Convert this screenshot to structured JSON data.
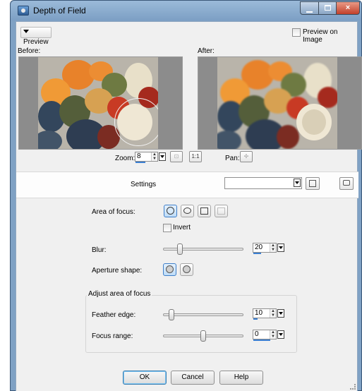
{
  "window": {
    "title": "Depth of Field",
    "colors": {
      "titlebar": "#7c9fc4",
      "client": "#f0f0f0",
      "accent": "#3b7fd2"
    }
  },
  "window_buttons": {
    "minimize": "minimize-icon",
    "maximize": "maximize-icon",
    "close": "close-icon",
    "close_glyph": "×"
  },
  "preview": {
    "toggle_label": "Preview",
    "preview_on_image_label": "Preview on Image"
  },
  "panes": {
    "before_label": "Before:",
    "after_label": "After:"
  },
  "zoom": {
    "label": "Zoom:",
    "value": "8"
  },
  "pan": {
    "label": "Pan:",
    "glyph": "✢"
  },
  "settings": {
    "label": "Settings",
    "selected": ""
  },
  "area_of_focus": {
    "label": "Area of focus:",
    "invert_label": "Invert",
    "shapes": [
      "circle-icon",
      "lasso-icon",
      "rectangle-icon",
      "rectangle-disabled-icon"
    ]
  },
  "blur": {
    "label": "Blur:",
    "value": "20"
  },
  "aperture": {
    "label": "Aperture shape:",
    "shapes": [
      "circle-aperture-icon",
      "round-aperture-icon"
    ]
  },
  "adjust": {
    "group_title": "Adjust area of focus",
    "feather_label": "Feather edge:",
    "feather_value": "10",
    "focus_label": "Focus range:",
    "focus_value": "0"
  },
  "buttons": {
    "ok": "OK",
    "cancel": "Cancel",
    "help": "Help"
  },
  "icons": {
    "zoom_reset": "⊡",
    "one_to_one": "1:1"
  }
}
